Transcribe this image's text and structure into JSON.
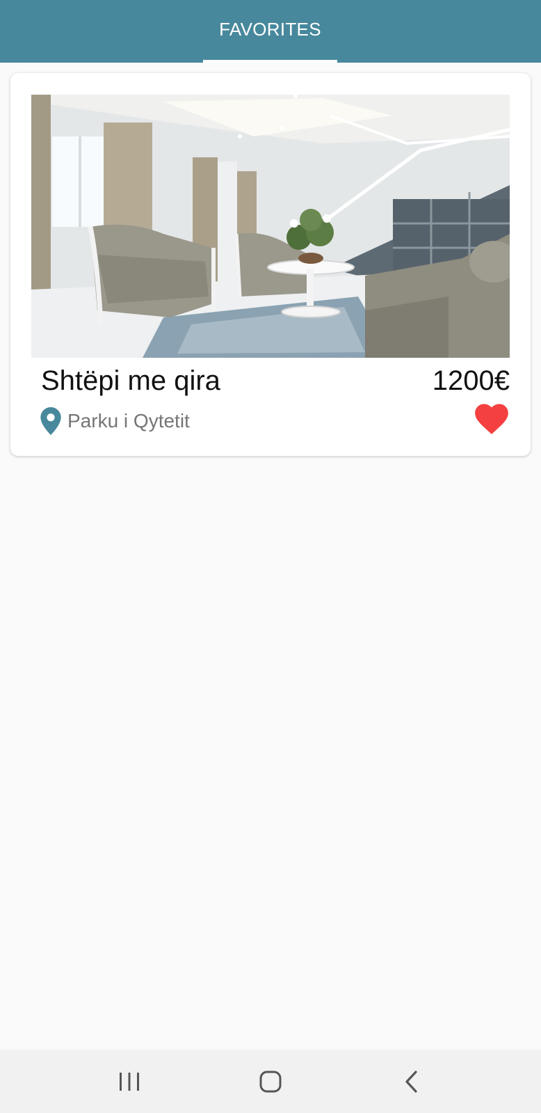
{
  "header": {
    "tab_label": "FAVORITES",
    "background": "#47889c"
  },
  "favorites": [
    {
      "title": "Shtëpi me qira",
      "price": "1200€",
      "location": "Parku i Qytetit",
      "image": "living-room-interior-photo",
      "favorited": true,
      "heart_color": "#f44040"
    }
  ],
  "icons": {
    "location": "location-pin-icon",
    "favorite": "heart-icon",
    "nav_recents": "recent-apps-icon",
    "nav_home": "home-icon",
    "nav_back": "back-icon"
  },
  "colors": {
    "accent": "#47889c",
    "heart": "#f44040",
    "page_bg": "#fafafa"
  }
}
